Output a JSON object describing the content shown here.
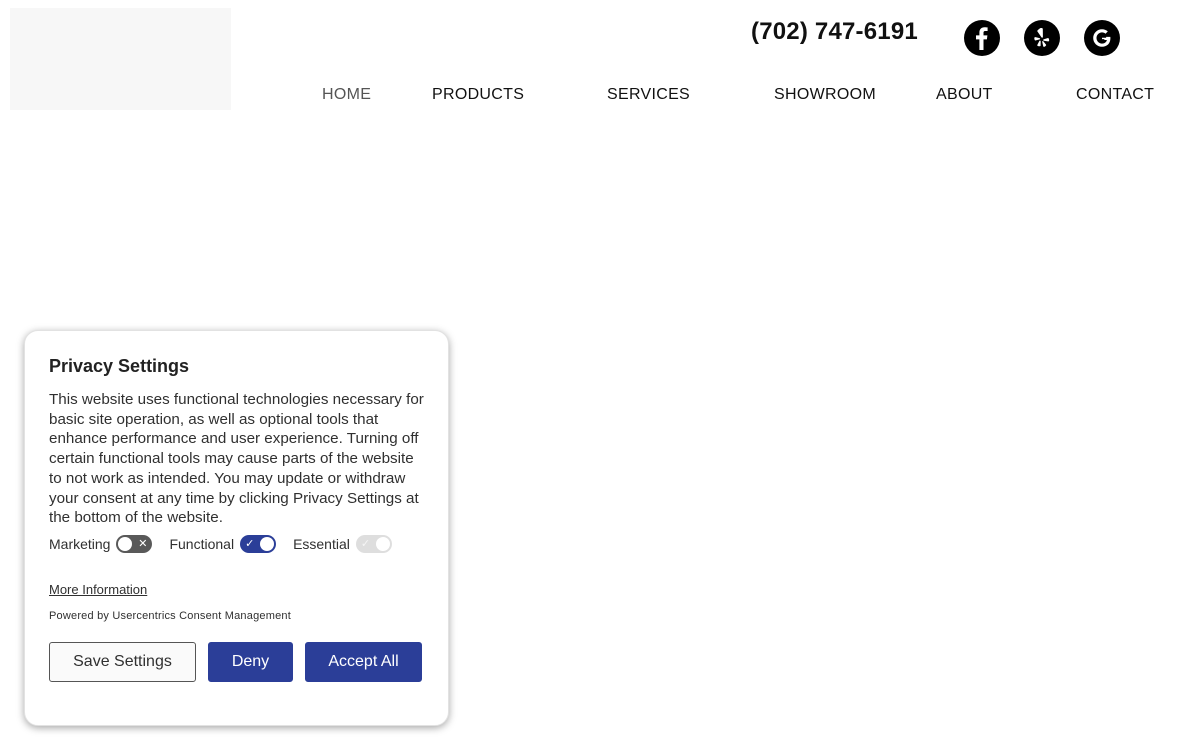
{
  "header": {
    "phone": "(702) 747-6191",
    "social": [
      {
        "icon": "facebook-icon",
        "label": "f"
      },
      {
        "icon": "yelp-icon",
        "label": "yelp"
      },
      {
        "icon": "google-icon",
        "label": "G"
      }
    ]
  },
  "nav": {
    "items": [
      {
        "label": "HOME",
        "active": true
      },
      {
        "label": "PRODUCTS",
        "active": false
      },
      {
        "label": "SERVICES",
        "active": false
      },
      {
        "label": "SHOWROOM",
        "active": false
      },
      {
        "label": "ABOUT",
        "active": false
      },
      {
        "label": "CONTACT",
        "active": false
      }
    ]
  },
  "consent": {
    "title": "Privacy Settings",
    "body": "This website uses functional technologies necessary for basic site operation, as well as optional tools that enhance performance and user experience. Turning off certain functional tools may cause parts of the website to not work as intended. You may update or withdraw your consent at any time by clicking Privacy Settings at the bottom of the website.",
    "toggles": [
      {
        "label": "Marketing",
        "state": "off"
      },
      {
        "label": "Functional",
        "state": "on"
      },
      {
        "label": "Essential",
        "state": "on-disabled"
      }
    ],
    "more_info": "More Information",
    "powered_by": "Powered by Usercentrics Consent Management",
    "buttons": {
      "save": "Save Settings",
      "deny": "Deny",
      "accept": "Accept All"
    }
  },
  "colors": {
    "accent": "#2b3e98",
    "text": "#303030",
    "toggle_off": "#595959",
    "toggle_disabled": "#dedede"
  }
}
